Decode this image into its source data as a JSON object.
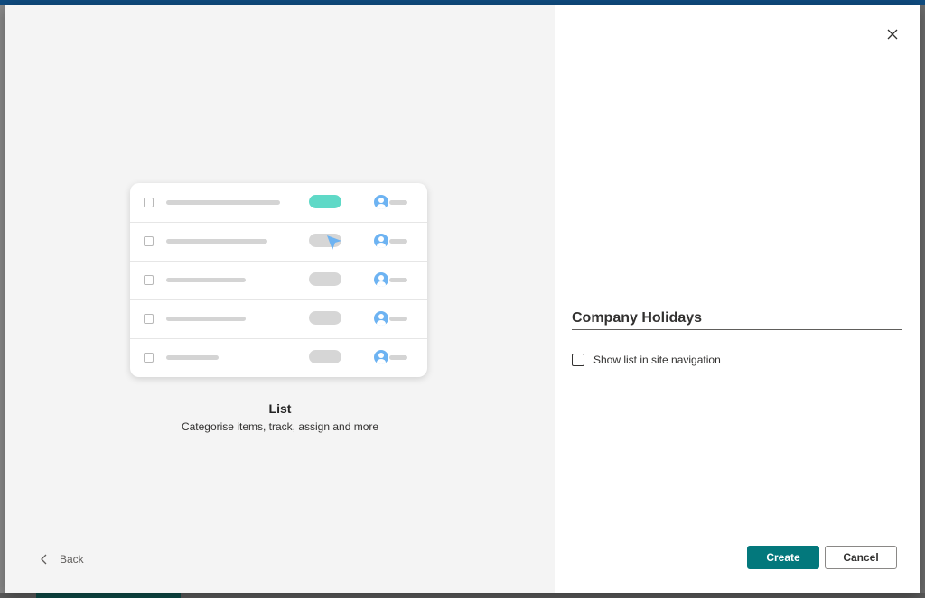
{
  "template": {
    "title": "List",
    "description": "Categorise items, track, assign and more"
  },
  "illustration": {
    "rows": [
      {
        "line_width": 126,
        "pill": "teal",
        "cursor": false
      },
      {
        "line_width": 112,
        "pill": "grey",
        "cursor": true
      },
      {
        "line_width": 88,
        "pill": "grey",
        "cursor": false
      },
      {
        "line_width": 88,
        "pill": "grey",
        "cursor": false
      },
      {
        "line_width": 58,
        "pill": "grey",
        "cursor": false
      }
    ],
    "colors": {
      "teal": "#5fd9c7",
      "avatar": "#6db3f2",
      "cursor": "#6db3f2"
    }
  },
  "form": {
    "name_value": "Company Holidays",
    "show_in_nav_label": "Show list in site navigation",
    "show_in_nav_checked": false
  },
  "buttons": {
    "back": "Back",
    "create": "Create",
    "cancel": "Cancel"
  },
  "colors": {
    "primary": "#03787c",
    "left_pane_bg": "#f4f4f4"
  }
}
